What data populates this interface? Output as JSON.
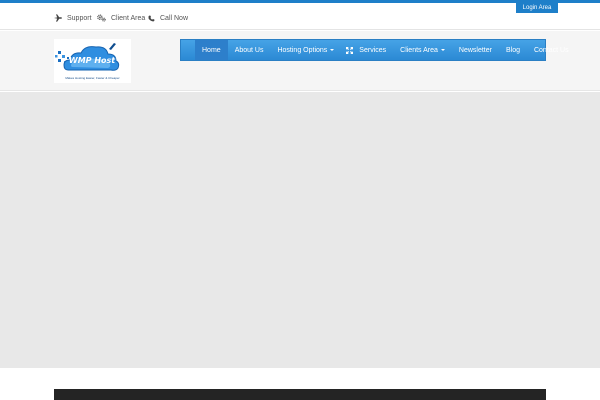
{
  "topbar": {
    "links": [
      {
        "label": "Support",
        "icon": "plane-icon"
      },
      {
        "label": "Client Area",
        "icon": "gears-icon"
      },
      {
        "label": "Call Now",
        "icon": "phone-icon"
      }
    ],
    "login_label": "Login Area"
  },
  "logo": {
    "text": "WMP Host",
    "caption": "Makes Hosting Easier, Faster & Cheaper"
  },
  "nav": {
    "items": [
      {
        "label": "Home"
      },
      {
        "label": "About Us"
      },
      {
        "label": "Hosting Options"
      },
      {
        "label": "Services"
      },
      {
        "label": "Clients Area"
      },
      {
        "label": "Newsletter"
      },
      {
        "label": "Blog"
      },
      {
        "label": "Contact Us"
      }
    ]
  },
  "colors": {
    "accent": "#1e7fc9",
    "nav_gradient_top": "#46a3e6",
    "nav_gradient_bottom": "#2b89d4",
    "hero_bg": "#e8e8e8",
    "footer_bar": "#242424"
  }
}
